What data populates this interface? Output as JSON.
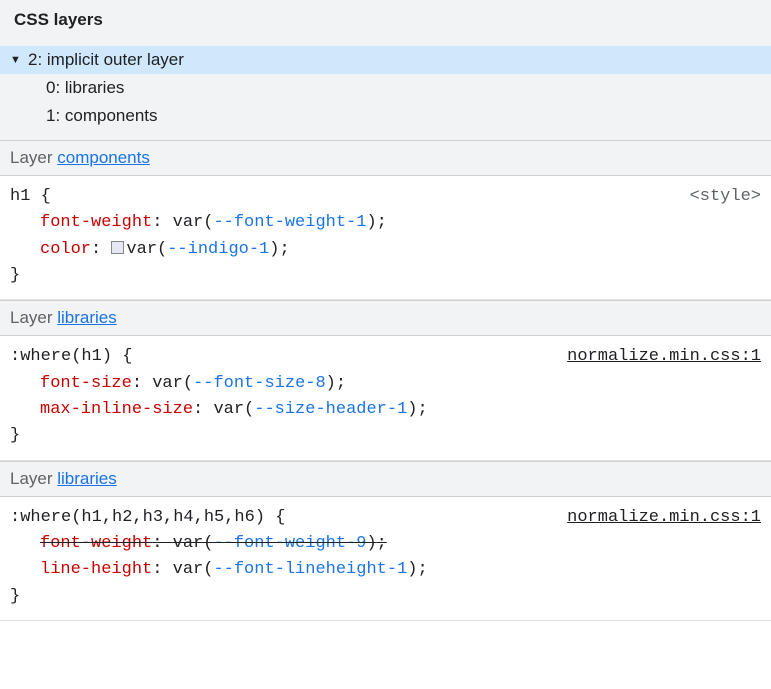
{
  "header": {
    "title": "CSS layers"
  },
  "tree": {
    "root": {
      "toggle": "▼",
      "label": "2: implicit outer layer"
    },
    "children": [
      {
        "label": "0: libraries"
      },
      {
        "label": "1: components"
      }
    ]
  },
  "layers": [
    {
      "prefix": "Layer ",
      "name": "components",
      "selector": "h1 {",
      "source": "<style>",
      "sourceLink": false,
      "decls": [
        {
          "prop": "font-weight",
          "funcOpen": "var(",
          "var": "--font-weight-1",
          "funcClose": ")",
          "strike": false,
          "swatch": false
        },
        {
          "prop": "color",
          "funcOpen": "var(",
          "var": "--indigo-1",
          "funcClose": ")",
          "strike": false,
          "swatch": true
        }
      ],
      "close": "}"
    },
    {
      "prefix": "Layer ",
      "name": "libraries",
      "selector": ":where(h1) {",
      "source": "normalize.min.css:1",
      "sourceLink": true,
      "decls": [
        {
          "prop": "font-size",
          "funcOpen": "var(",
          "var": "--font-size-8",
          "funcClose": ")",
          "strike": false,
          "swatch": false
        },
        {
          "prop": "max-inline-size",
          "funcOpen": "var(",
          "var": "--size-header-1",
          "funcClose": ")",
          "strike": false,
          "swatch": false
        }
      ],
      "close": "}"
    },
    {
      "prefix": "Layer ",
      "name": "libraries",
      "selector": ":where(h1,h2,h3,h4,h5,h6) {",
      "source": "normalize.min.css:1",
      "sourceLink": true,
      "decls": [
        {
          "prop": "font-weight",
          "funcOpen": "var(",
          "var": "--font-weight-9",
          "funcClose": ")",
          "strike": true,
          "swatch": false
        },
        {
          "prop": "line-height",
          "funcOpen": "var(",
          "var": "--font-lineheight-1",
          "funcClose": ")",
          "strike": false,
          "swatch": false
        }
      ],
      "close": "}"
    }
  ]
}
